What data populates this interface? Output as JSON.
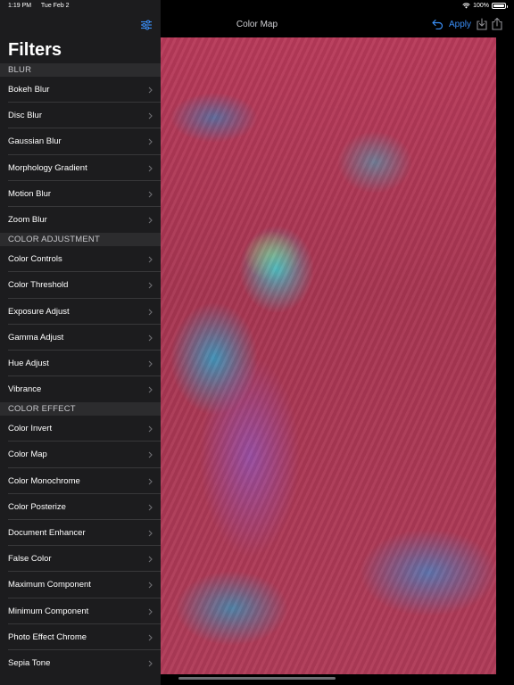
{
  "status_bar": {
    "time": "1:19 PM",
    "date": "Tue Feb 2",
    "battery": "100%",
    "battery_level": 1.0
  },
  "sidebar": {
    "title": "Filters",
    "toggle_icon": "sliders-icon",
    "sections": [
      {
        "header": "BLUR",
        "items": [
          "Bokeh Blur",
          "Disc Blur",
          "Gaussian Blur",
          "Morphology Gradient",
          "Motion Blur",
          "Zoom Blur"
        ]
      },
      {
        "header": "COLOR ADJUSTMENT",
        "items": [
          "Color Controls",
          "Color Threshold",
          "Exposure Adjust",
          "Gamma Adjust",
          "Hue Adjust",
          "Vibrance"
        ]
      },
      {
        "header": "COLOR EFFECT",
        "items": [
          "Color Invert",
          "Color Map",
          "Color Monochrome",
          "Color Posterize",
          "Document Enhancer",
          "False Color",
          "Maximum Component",
          "Minimum Component",
          "Photo Effect Chrome",
          "Sepia Tone"
        ]
      }
    ]
  },
  "main": {
    "title": "Color Map",
    "apply_label": "Apply",
    "icons": [
      "undo-icon",
      "save-icon",
      "share-icon"
    ]
  },
  "colors": {
    "accent": "#3a8ef6",
    "sidebar_bg": "#1c1c1e",
    "section_bg": "#2c2c2e"
  }
}
